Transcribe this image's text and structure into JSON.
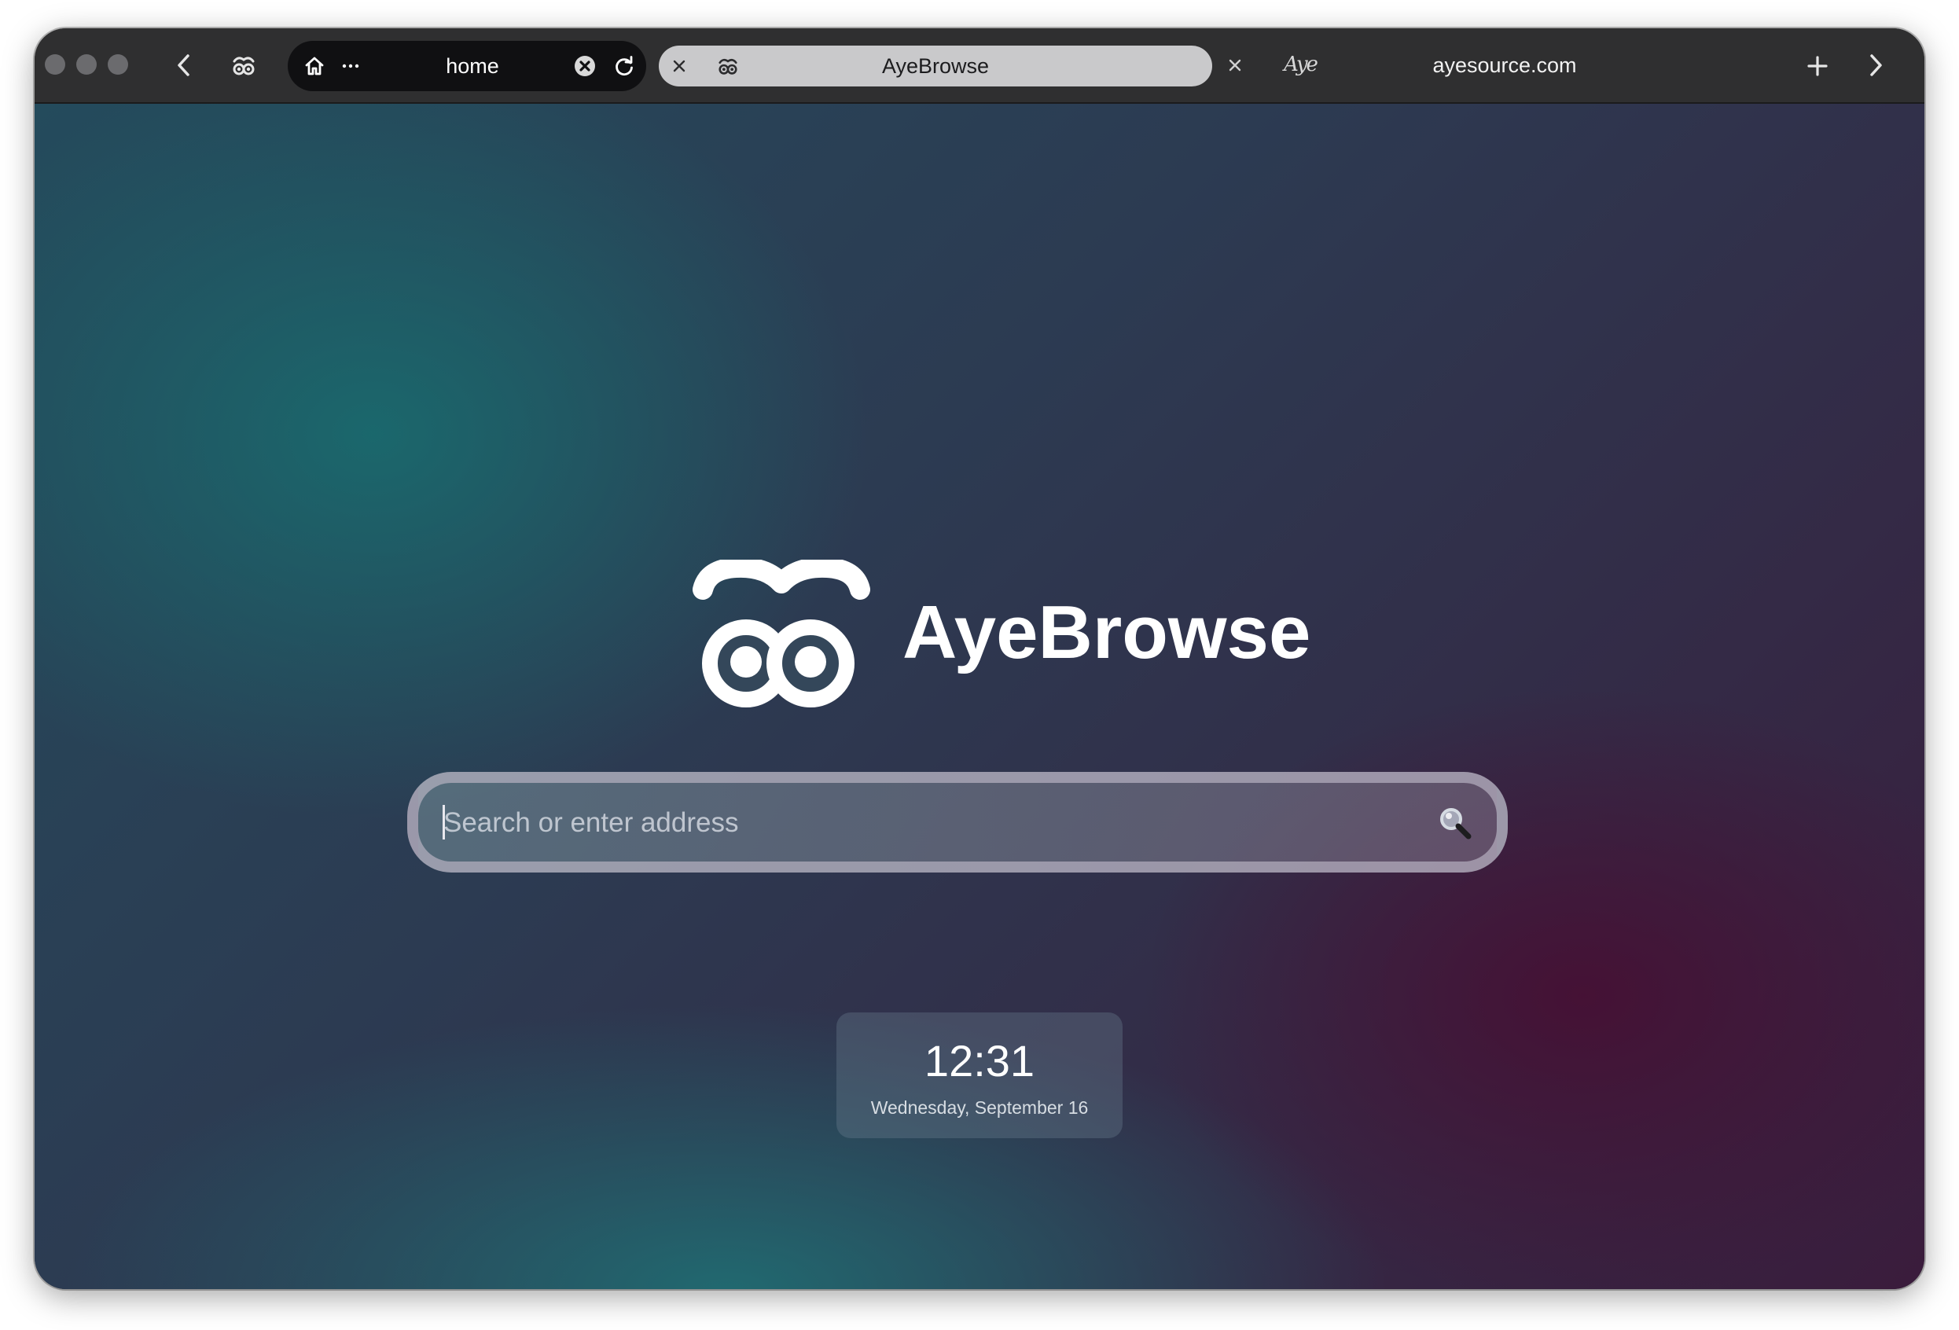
{
  "toolbar": {
    "active_tab": {
      "title": "home"
    },
    "second_tab": {
      "title": "AyeBrowse"
    },
    "third_tab": {
      "favicon_text": "Aye",
      "url": "ayesource.com"
    }
  },
  "home": {
    "brand": "AyeBrowse",
    "search": {
      "placeholder": "Search or enter address",
      "value": ""
    },
    "clock": {
      "time": "12:31",
      "date": "Wednesday, September 16"
    }
  },
  "icons": {
    "back": "chevron-left-icon",
    "forward": "chevron-right-icon",
    "home": "home-icon",
    "more": "ellipsis-icon",
    "close": "close-icon",
    "reload": "reload-icon",
    "new_tab": "plus-icon",
    "search": "magnifier-icon",
    "logo": "ayebrowse-eyes-logo"
  },
  "colors": {
    "toolbar": "#2f2f30",
    "active_tab": "#101012",
    "second_tab": "#c9c9cb",
    "bg_teal": "#1c6c70",
    "bg_purple": "#3a1c3c"
  }
}
